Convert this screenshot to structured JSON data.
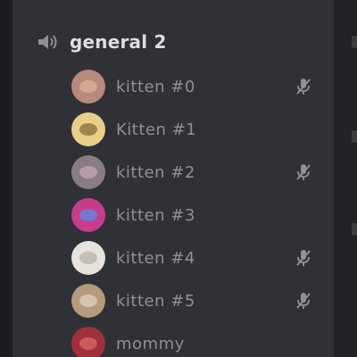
{
  "voice_channel": {
    "name": "general 2",
    "icon": "speaker-icon"
  },
  "users": [
    {
      "name": "kitten #0",
      "muted": true,
      "avatar_color": "#b98a7a",
      "avatar_accent": "#d9b0a0"
    },
    {
      "name": "Kitten #1",
      "muted": false,
      "avatar_color": "#e7cf8a",
      "avatar_accent": "#8a6a3a"
    },
    {
      "name": "kitten #2",
      "muted": true,
      "avatar_color": "#8a7d82",
      "avatar_accent": "#c9a6b8"
    },
    {
      "name": "kitten #3",
      "muted": false,
      "avatar_color": "#c83c8c",
      "avatar_accent": "#5a8ce0"
    },
    {
      "name": "kitten #4",
      "muted": true,
      "avatar_color": "#e6e2dc",
      "avatar_accent": "#b8b2aa"
    },
    {
      "name": "kitten #5",
      "muted": true,
      "avatar_color": "#b59a7c",
      "avatar_accent": "#e2d2bc"
    },
    {
      "name": "mommy",
      "muted": false,
      "avatar_color": "#a0303a",
      "avatar_accent": "#d86a6a"
    }
  ],
  "colors": {
    "panel": "#2f3136",
    "channel_text": "#dcddde",
    "user_text": "#8e9297",
    "icon": "#8e9297"
  },
  "icons": {
    "mute": "mic-muted-icon"
  }
}
